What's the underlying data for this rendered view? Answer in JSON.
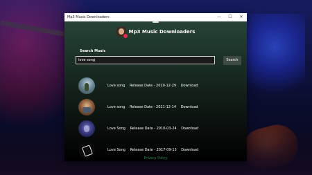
{
  "window": {
    "title": "Mp3 Music Downloaders",
    "controls": {
      "minimize": "—",
      "maximize": "☐",
      "close": "✕"
    }
  },
  "header": {
    "app_title": "Mp3 Music Downloaders"
  },
  "search": {
    "label": "Search Music",
    "value": "love song",
    "button_label": "Search"
  },
  "results": [
    {
      "title": "Love song",
      "release": "Release Date - 2010-12-29",
      "download": "Download"
    },
    {
      "title": "Love song",
      "release": "Release Date - 2021-12-14",
      "download": "Download"
    },
    {
      "title": "Love Song",
      "release": "Release Date - 2010-03-24",
      "download": "Download"
    },
    {
      "title": "Love Song",
      "release": "Release Date - 2017-09-13",
      "download": "Download"
    }
  ],
  "footer": {
    "privacy": "Privacy Policy"
  }
}
